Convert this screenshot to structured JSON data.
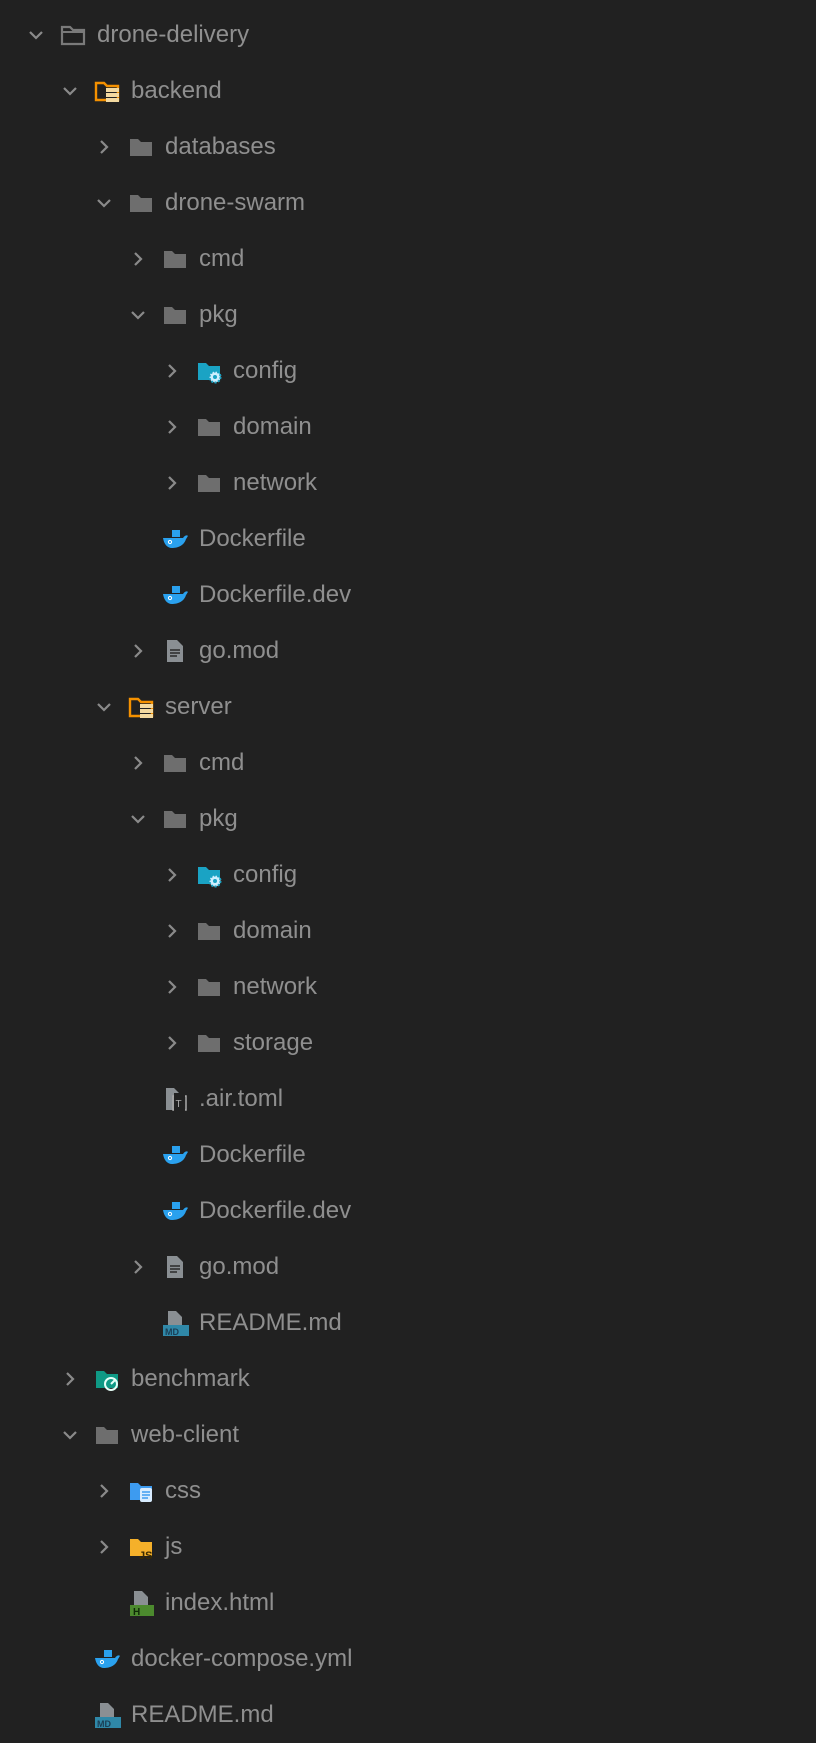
{
  "tree": [
    {
      "label": "drone-delivery",
      "level": 0,
      "chevron": "down",
      "icon": "folder-outline-icon"
    },
    {
      "label": "backend",
      "level": 1,
      "chevron": "down",
      "icon": "folder-server-icon"
    },
    {
      "label": "databases",
      "level": 2,
      "chevron": "right",
      "icon": "folder-icon"
    },
    {
      "label": "drone-swarm",
      "level": 2,
      "chevron": "down",
      "icon": "folder-icon"
    },
    {
      "label": "cmd",
      "level": 3,
      "chevron": "right",
      "icon": "folder-icon"
    },
    {
      "label": "pkg",
      "level": 3,
      "chevron": "down",
      "icon": "folder-icon"
    },
    {
      "label": "config",
      "level": 4,
      "chevron": "right",
      "icon": "folder-config-icon"
    },
    {
      "label": "domain",
      "level": 4,
      "chevron": "right",
      "icon": "folder-icon"
    },
    {
      "label": "network",
      "level": 4,
      "chevron": "right",
      "icon": "folder-icon"
    },
    {
      "label": "Dockerfile",
      "level": 3,
      "chevron": "none",
      "icon": "docker-icon"
    },
    {
      "label": "Dockerfile.dev",
      "level": 3,
      "chevron": "none",
      "icon": "docker-icon"
    },
    {
      "label": "go.mod",
      "level": 3,
      "chevron": "right",
      "icon": "file-doc-icon"
    },
    {
      "label": "server",
      "level": 2,
      "chevron": "down",
      "icon": "folder-server-icon"
    },
    {
      "label": "cmd",
      "level": 3,
      "chevron": "right",
      "icon": "folder-icon"
    },
    {
      "label": "pkg",
      "level": 3,
      "chevron": "down",
      "icon": "folder-icon"
    },
    {
      "label": "config",
      "level": 4,
      "chevron": "right",
      "icon": "folder-config-icon"
    },
    {
      "label": "domain",
      "level": 4,
      "chevron": "right",
      "icon": "folder-icon"
    },
    {
      "label": "network",
      "level": 4,
      "chevron": "right",
      "icon": "folder-icon"
    },
    {
      "label": "storage",
      "level": 4,
      "chevron": "right",
      "icon": "folder-icon"
    },
    {
      "label": ".air.toml",
      "level": 3,
      "chevron": "none",
      "icon": "toml-file-icon"
    },
    {
      "label": "Dockerfile",
      "level": 3,
      "chevron": "none",
      "icon": "docker-icon"
    },
    {
      "label": "Dockerfile.dev",
      "level": 3,
      "chevron": "none",
      "icon": "docker-icon"
    },
    {
      "label": "go.mod",
      "level": 3,
      "chevron": "right",
      "icon": "file-doc-icon"
    },
    {
      "label": "README.md",
      "level": 3,
      "chevron": "none",
      "icon": "markdown-icon"
    },
    {
      "label": "benchmark",
      "level": 1,
      "chevron": "right",
      "icon": "folder-benchmark-icon"
    },
    {
      "label": "web-client",
      "level": 1,
      "chevron": "down",
      "icon": "folder-icon"
    },
    {
      "label": "css",
      "level": 2,
      "chevron": "right",
      "icon": "folder-css-icon"
    },
    {
      "label": "js",
      "level": 2,
      "chevron": "right",
      "icon": "folder-js-icon"
    },
    {
      "label": "index.html",
      "level": 2,
      "chevron": "none",
      "icon": "html-file-icon"
    },
    {
      "label": "docker-compose.yml",
      "level": 1,
      "chevron": "none",
      "icon": "docker-icon"
    },
    {
      "label": "README.md",
      "level": 1,
      "chevron": "none",
      "icon": "markdown-icon"
    }
  ],
  "colors": {
    "text": "#8f8f8f",
    "folder": "#6e6e6e",
    "server": "#f59100",
    "config": "#1aa3c4",
    "docker": "#2aa1ee",
    "benchmark": "#0f9985",
    "css": "#3d9bf0",
    "js": "#f5b02a",
    "html": "#4c8a2e",
    "md": "#2f88a8"
  }
}
